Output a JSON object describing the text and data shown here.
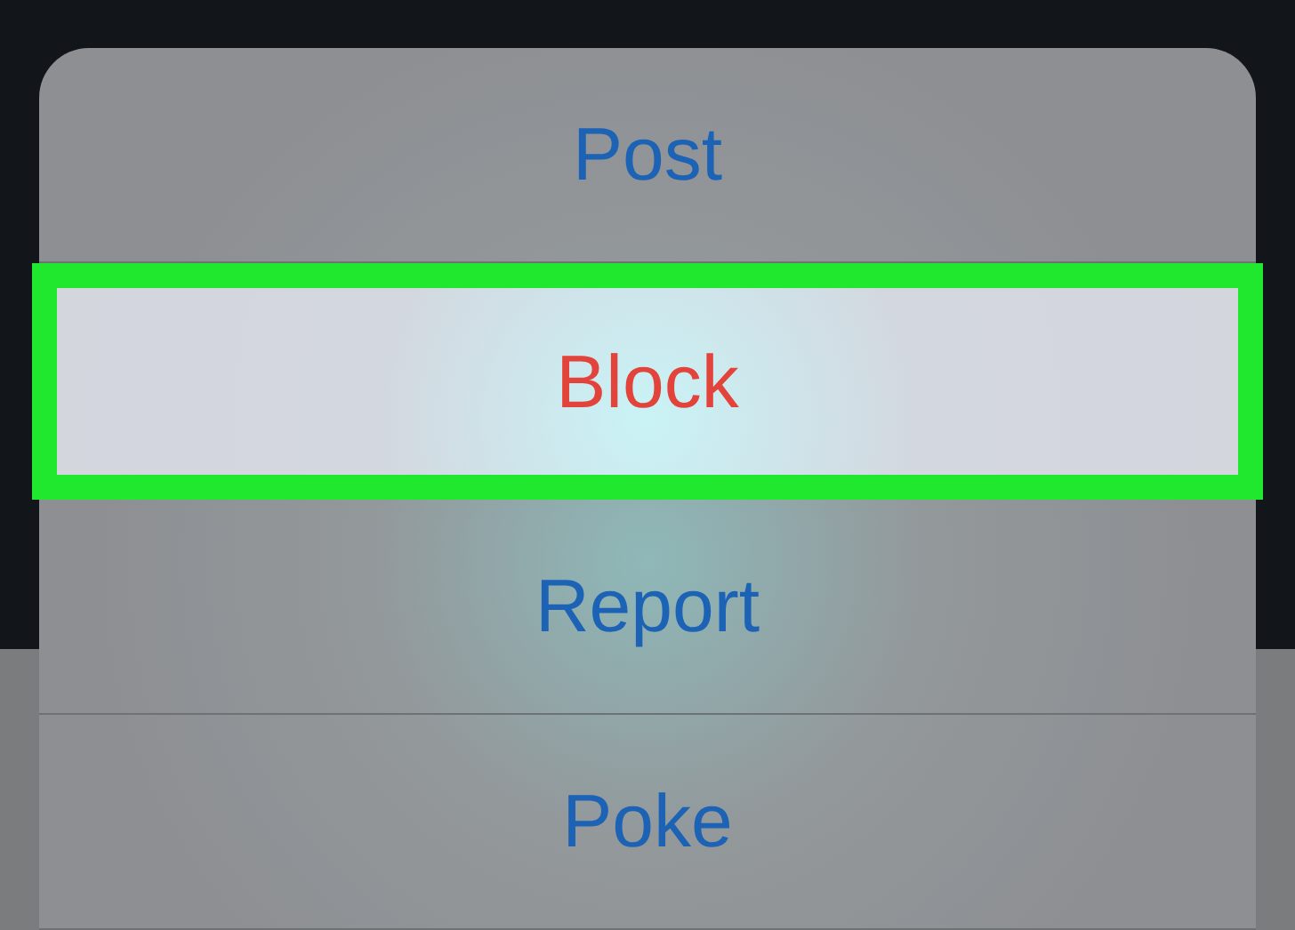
{
  "action_sheet": {
    "items": [
      {
        "label": "Post",
        "kind": "default",
        "highlighted": false
      },
      {
        "label": "Block",
        "kind": "destructive",
        "highlighted": true
      },
      {
        "label": "Report",
        "kind": "default",
        "highlighted": false
      },
      {
        "label": "Poke",
        "kind": "default",
        "highlighted": false
      }
    ]
  }
}
